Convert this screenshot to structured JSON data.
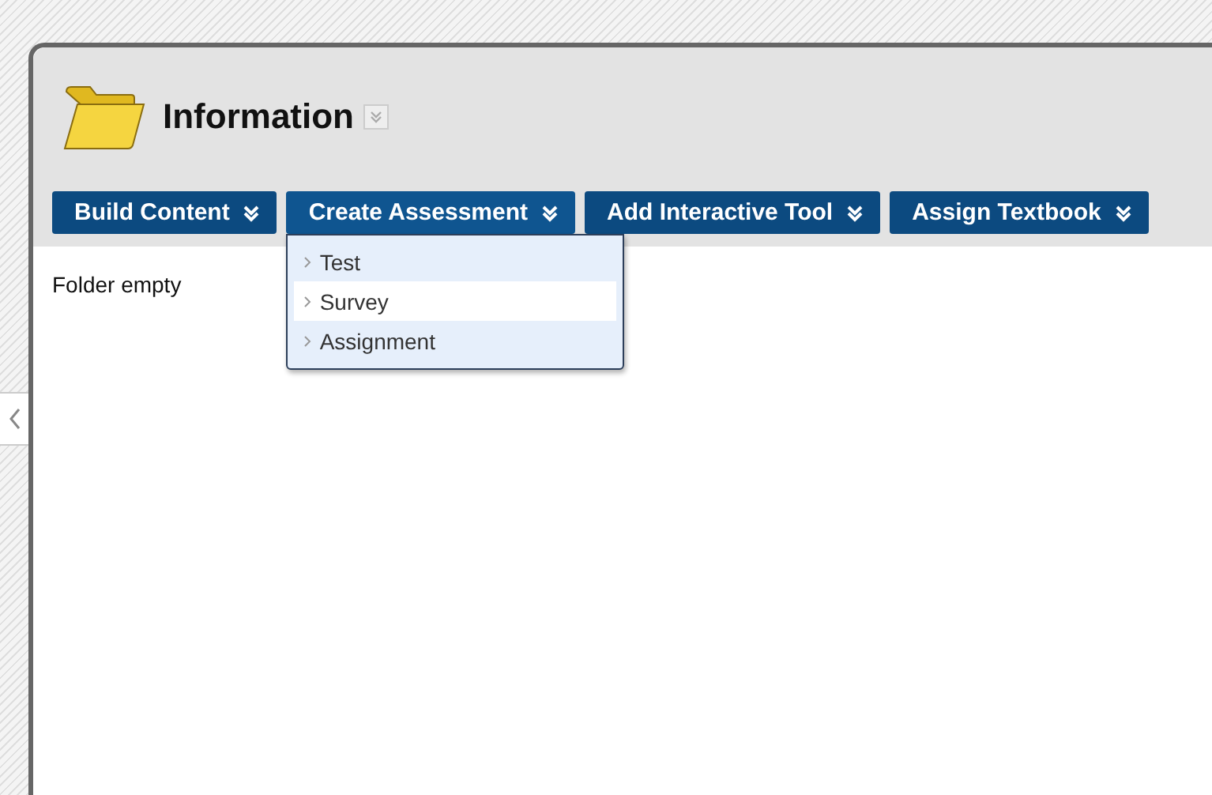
{
  "page": {
    "title": "Information"
  },
  "toolbar": [
    {
      "label": "Build Content",
      "expanded": false
    },
    {
      "label": "Create Assessment",
      "expanded": true
    },
    {
      "label": "Add Interactive Tool",
      "expanded": false
    },
    {
      "label": "Assign Textbook",
      "expanded": false
    }
  ],
  "menu": [
    {
      "label": "Test",
      "selected": false
    },
    {
      "label": "Survey",
      "selected": true
    },
    {
      "label": "Assignment",
      "selected": false
    }
  ],
  "content": {
    "message": "Folder empty"
  }
}
